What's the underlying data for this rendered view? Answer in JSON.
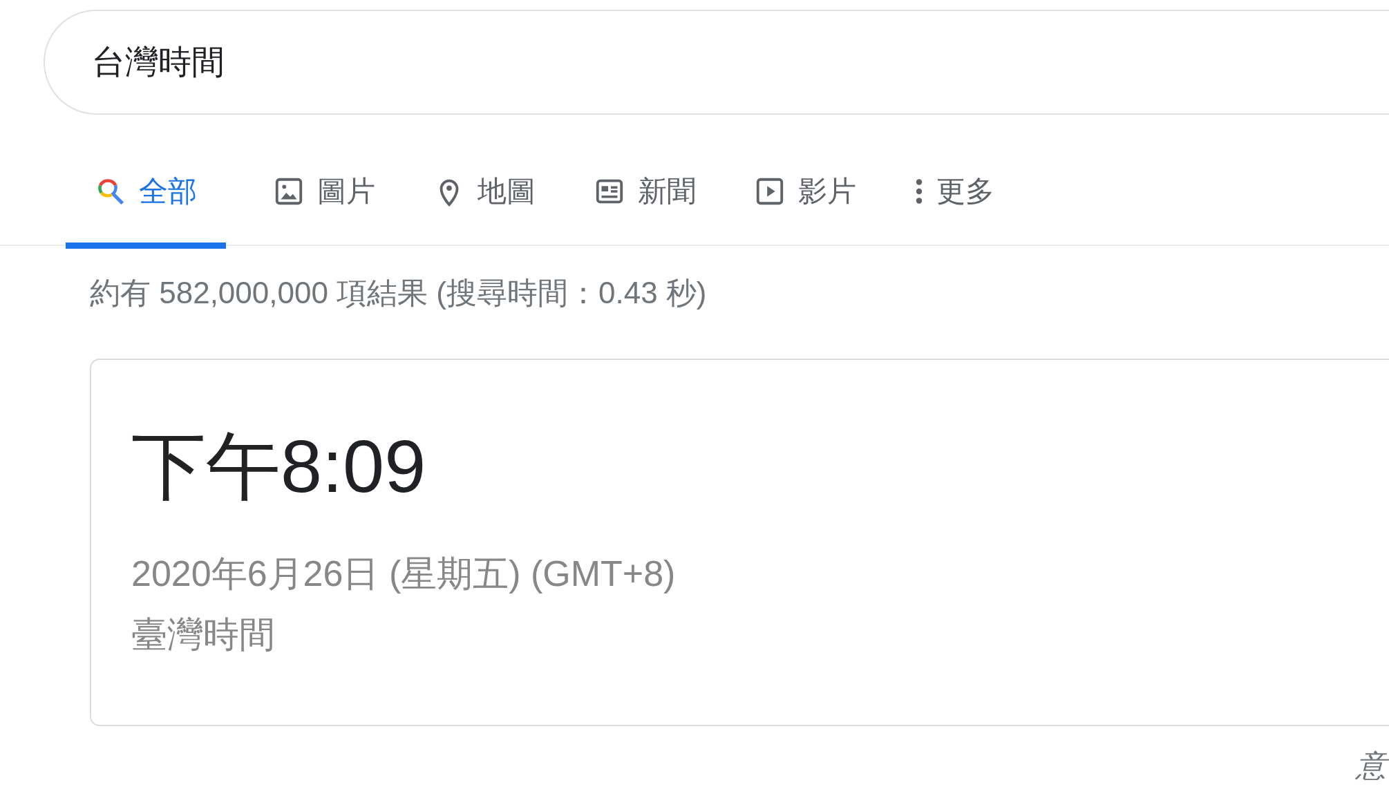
{
  "search": {
    "value": "台灣時間"
  },
  "tabs": [
    {
      "label": "全部",
      "kind": "all",
      "selected": true
    },
    {
      "label": "圖片",
      "kind": "images",
      "selected": false
    },
    {
      "label": "地圖",
      "kind": "maps",
      "selected": false
    },
    {
      "label": "新聞",
      "kind": "news",
      "selected": false
    },
    {
      "label": "影片",
      "kind": "videos",
      "selected": false
    },
    {
      "label": "更多",
      "kind": "more",
      "selected": false
    }
  ],
  "result_stats": "約有 582,000,000 項結果 (搜尋時間：0.43 秒)",
  "clock_card": {
    "period": "下午",
    "time": "8:09",
    "date": "2020年6月26日 (星期五) (GMT+8)",
    "zone": "臺灣時間"
  },
  "feedback": "意"
}
